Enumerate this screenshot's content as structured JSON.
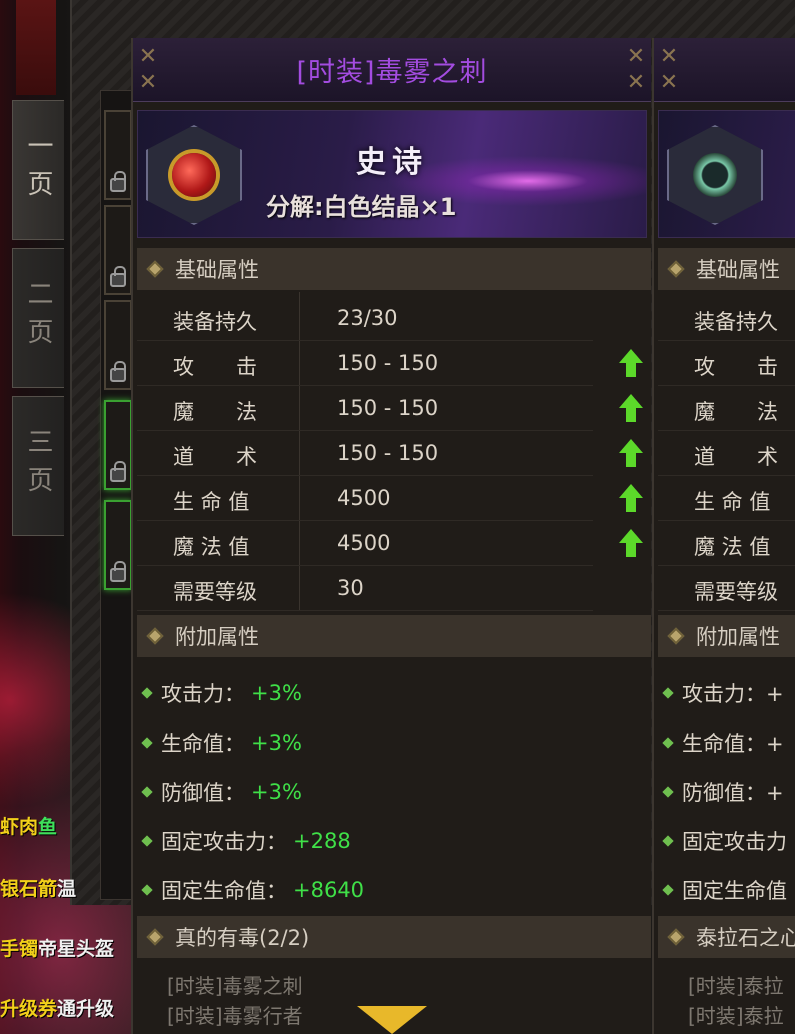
{
  "page_tabs": [
    "一页",
    "二页",
    "三页"
  ],
  "chat": [
    {
      "text": "虾肉",
      "color": "y",
      "suffix": "鱼",
      "suffix_color": "g"
    },
    {
      "text": "银石箭",
      "color": "y",
      "suffix": "温",
      "suffix_color": "w"
    },
    {
      "text": "手镯",
      "color": "y",
      "suffix": "帝星头盔",
      "suffix_color": "w"
    },
    {
      "text": "升级券",
      "color": "y",
      "suffix": "通升级",
      "suffix_color": "w"
    }
  ],
  "item": {
    "title": "[时装]毒雾之刺",
    "rarity": "史诗",
    "decompose": "分解:白色结晶×1",
    "base_section": "基础属性",
    "base_stats": [
      {
        "name": "装备持久",
        "value": "23/30",
        "up": false
      },
      {
        "name": "攻　　击",
        "value": "150 - 150",
        "up": true
      },
      {
        "name": "魔　　法",
        "value": "150 - 150",
        "up": true
      },
      {
        "name": "道　　术",
        "value": "150 - 150",
        "up": true
      },
      {
        "name": "生 命 值",
        "value": "4500",
        "up": true
      },
      {
        "name": "魔 法 值",
        "value": "4500",
        "up": true
      },
      {
        "name": "需要等级",
        "value": "30",
        "up": false
      }
    ],
    "extra_section": "附加属性",
    "extra_stats": [
      {
        "name": "攻击力：",
        "value": "+3%"
      },
      {
        "name": "生命值：",
        "value": "+3%"
      },
      {
        "name": "防御值：",
        "value": "+3%"
      },
      {
        "name": "固定攻击力：",
        "value": "+288"
      },
      {
        "name": "固定生命值：",
        "value": "+8640"
      }
    ],
    "set_section": "真的有毒(2/2)",
    "set_items": [
      "[时装]毒雾之刺",
      "[时装]毒雾行者"
    ]
  },
  "compare": {
    "base_section": "基础属性",
    "stat_names": [
      "装备持久",
      "攻　　击",
      "魔　　法",
      "道　　术",
      "生 命 值",
      "魔 法 值",
      "需要等级"
    ],
    "extra_section": "附加属性",
    "extra_names": [
      "攻击力：+",
      "生命值：+",
      "防御值：+",
      "固定攻击力",
      "固定生命值"
    ],
    "set_section": "泰拉石之心",
    "set_items": [
      "[时装]泰拉",
      "[时装]泰拉"
    ]
  }
}
